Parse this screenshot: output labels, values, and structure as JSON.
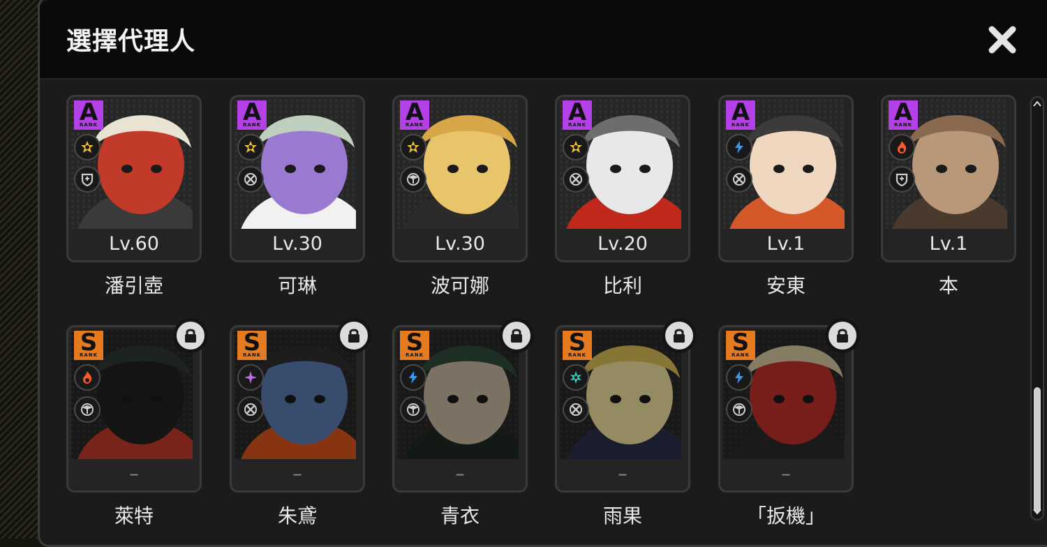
{
  "dialog": {
    "title": "選擇代理人",
    "close_icon": "close-icon"
  },
  "colors": {
    "rank_a": "#b440e8",
    "rank_s": "#e57a1f",
    "card_bg": "#242424",
    "header_bg": "#0a0a0a"
  },
  "agents": [
    {
      "name": "潘引壺",
      "level": "Lv.60",
      "rank": "A",
      "rank_sub": "RANK",
      "element_icon": "physical-icon",
      "role_icon": "defense-icon",
      "locked": false
    },
    {
      "name": "可琳",
      "level": "Lv.30",
      "rank": "A",
      "rank_sub": "RANK",
      "element_icon": "physical-icon",
      "role_icon": "attack-icon",
      "locked": false
    },
    {
      "name": "波可娜",
      "level": "Lv.30",
      "rank": "A",
      "rank_sub": "RANK",
      "element_icon": "physical-icon",
      "role_icon": "stun-icon",
      "locked": false
    },
    {
      "name": "比利",
      "level": "Lv.20",
      "rank": "A",
      "rank_sub": "RANK",
      "element_icon": "physical-icon",
      "role_icon": "attack-icon",
      "locked": false
    },
    {
      "name": "安東",
      "level": "Lv.1",
      "rank": "A",
      "rank_sub": "RANK",
      "element_icon": "electric-icon",
      "role_icon": "attack-icon",
      "locked": false
    },
    {
      "name": "本",
      "level": "Lv.1",
      "rank": "A",
      "rank_sub": "RANK",
      "element_icon": "fire-icon",
      "role_icon": "defense-icon",
      "locked": false
    },
    {
      "name": "萊特",
      "level": "–",
      "rank": "S",
      "rank_sub": "RANK",
      "element_icon": "fire-icon",
      "role_icon": "stun-icon",
      "locked": true
    },
    {
      "name": "朱鳶",
      "level": "–",
      "rank": "S",
      "rank_sub": "RANK",
      "element_icon": "ether-icon",
      "role_icon": "attack-icon",
      "locked": true
    },
    {
      "name": "青衣",
      "level": "–",
      "rank": "S",
      "rank_sub": "RANK",
      "element_icon": "electric-icon",
      "role_icon": "stun-icon",
      "locked": true
    },
    {
      "name": "雨果",
      "level": "–",
      "rank": "S",
      "rank_sub": "RANK",
      "element_icon": "ice-icon",
      "role_icon": "attack-icon",
      "locked": true
    },
    {
      "name": "「扳機」",
      "level": "–",
      "rank": "S",
      "rank_sub": "RANK",
      "element_icon": "electric-icon",
      "role_icon": "stun-icon",
      "locked": true
    }
  ]
}
